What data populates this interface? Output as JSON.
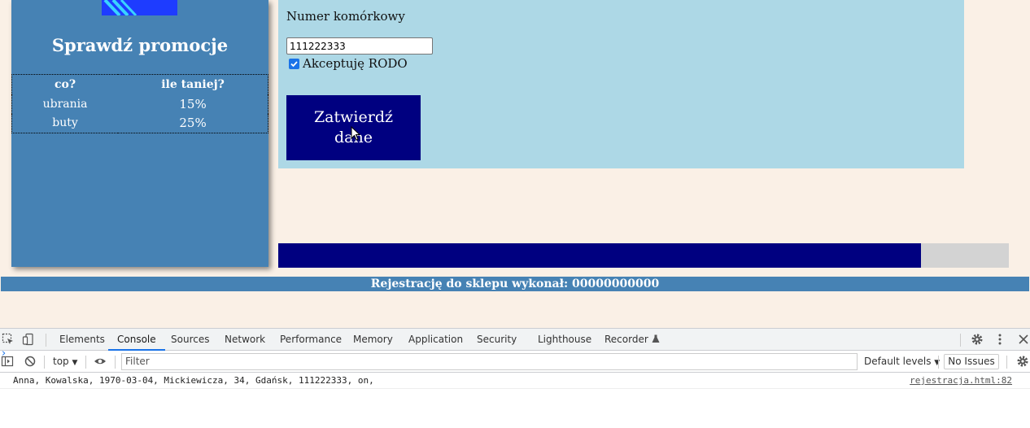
{
  "sidebar": {
    "title": "Sprawdź promocje",
    "table": {
      "headers": [
        "co?",
        "ile taniej?"
      ],
      "rows": [
        [
          "ubrania",
          "15%"
        ],
        [
          "buty",
          "25%"
        ]
      ]
    }
  },
  "form": {
    "phone_label": "Numer komórkowy",
    "phone_value": "111222333",
    "rodo_label": "Akceptuję RODO",
    "rodo_checked": true,
    "submit_line1": "Zatwierdź",
    "submit_line2": "dane"
  },
  "progress": {
    "value_percent": 88
  },
  "footer": {
    "text": "Rejestrację do sklepu wykonał: 00000000000"
  },
  "devtools": {
    "tabs": [
      "Elements",
      "Console",
      "Sources",
      "Network",
      "Performance",
      "Memory",
      "Application",
      "Security",
      "Lighthouse",
      "Recorder"
    ],
    "active_tab": "Console",
    "context": "top",
    "filter_placeholder": "Filter",
    "levels": "Default levels",
    "issues": "No Issues",
    "console_message": "Anna, Kowalska, 1970-03-04, Mickiewicza, 34, Gdańsk, 111222333, on,",
    "console_source": "rejestracja.html:82",
    "prompt": "›"
  },
  "colors": {
    "sidebar": "#4682b4",
    "panel": "#add8e6",
    "button": "#000080",
    "page": "#faf0e6"
  },
  "icons": [
    "inspect-icon",
    "device-toggle-icon",
    "gear-icon",
    "more-vertical-icon",
    "close-icon",
    "sidebar-toggle-icon",
    "clear-console-icon",
    "eye-icon",
    "recorder-flask-icon",
    "cursor-icon"
  ]
}
